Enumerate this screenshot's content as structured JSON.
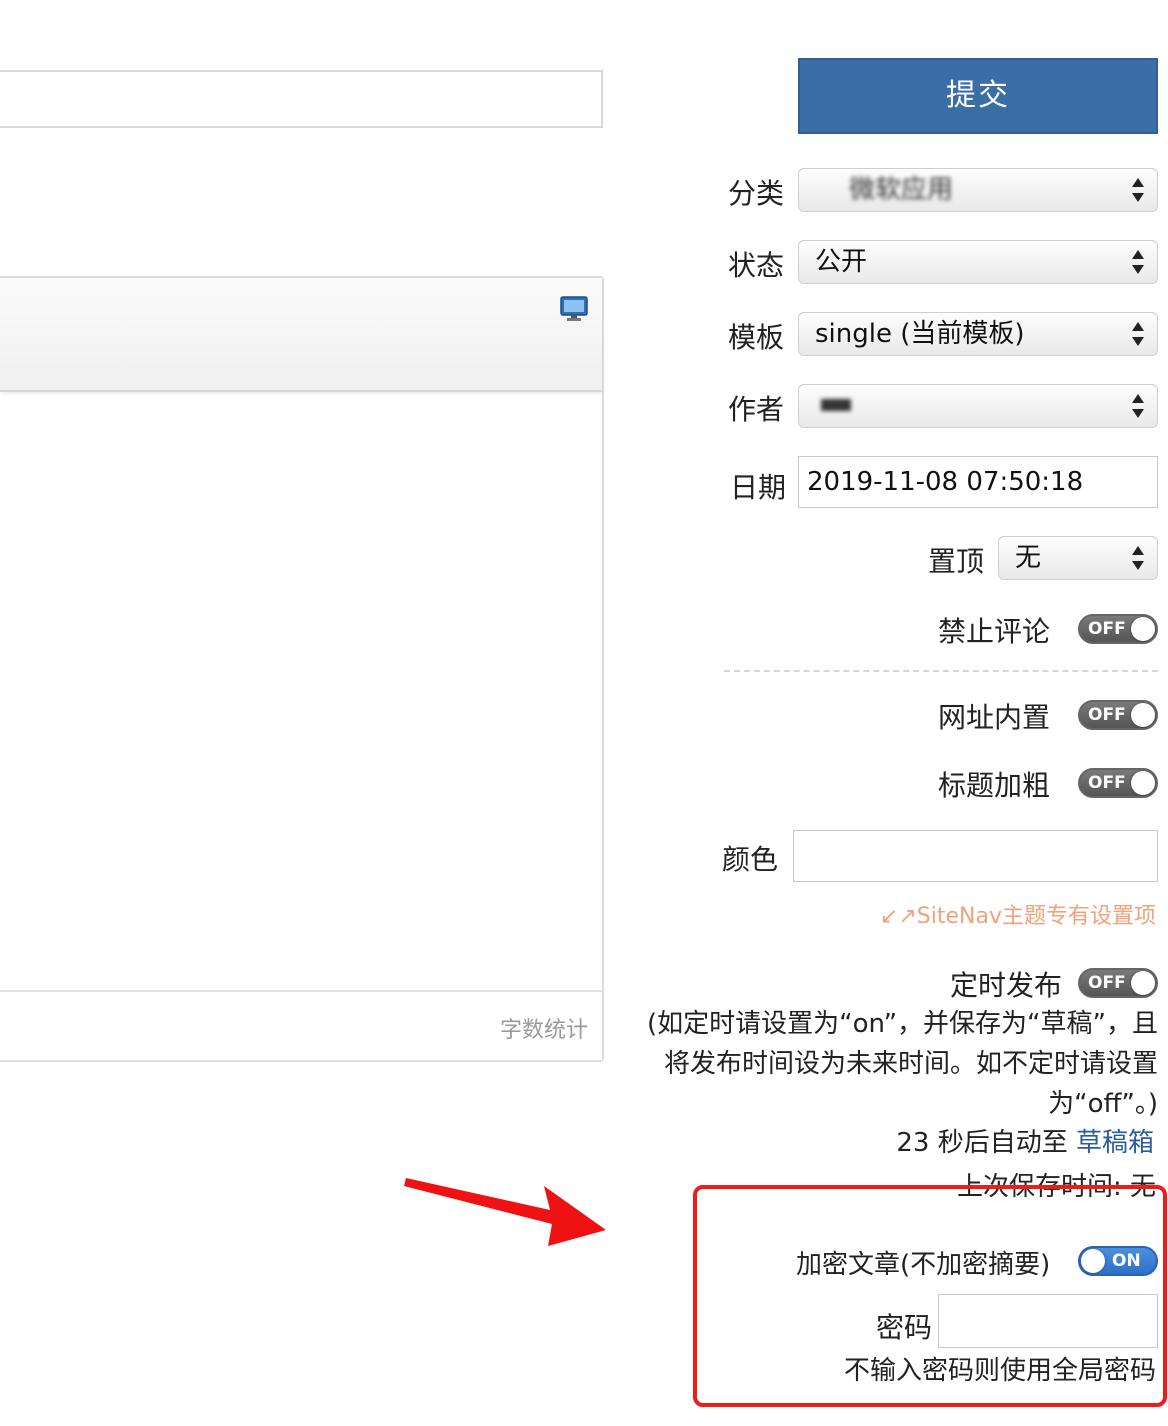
{
  "submit_label": "提交",
  "fields": {
    "category": {
      "label": "分类",
      "value": "微软应用"
    },
    "status": {
      "label": "状态",
      "value": "公开"
    },
    "template": {
      "label": "模板",
      "value": "single (当前模板)"
    },
    "author": {
      "label": "作者",
      "value": ""
    },
    "date": {
      "label": "日期",
      "value": "2019-11-08 07:50:18"
    },
    "sticky": {
      "label": "置顶",
      "value": "无"
    },
    "disable_comments": {
      "label": "禁止评论",
      "state": "OFF"
    },
    "url_builtin": {
      "label": "网址内置",
      "state": "OFF"
    },
    "bold_title": {
      "label": "标题加粗",
      "state": "OFF"
    },
    "color": {
      "label": "颜色",
      "value": ""
    },
    "theme_note": "↙↗SiteNav主题专有设置项",
    "scheduled": {
      "label": "定时发布",
      "state": "OFF"
    },
    "scheduled_help": "(如定时请设置为“on”，并保存为“草稿”，且将发布时间设为未来时间。如不定时请设置为“off”。)",
    "encrypt": {
      "label": "加密文章(不加密摘要)",
      "state": "ON"
    },
    "password": {
      "label": "密码",
      "value": "",
      "hint": "不输入密码则使用全局密码"
    }
  },
  "autosave": {
    "prefix": "23 秒后自动至 ",
    "link": "草稿箱",
    "last_saved": "上次保存时间: 无"
  },
  "editor": {
    "word_count_label": "字数统计"
  },
  "colors": {
    "submit_bg": "#3a6ea5",
    "toggle_on": "#2e6fc8",
    "toggle_off": "#555555",
    "highlight_box": "#ee1b1b",
    "theme_note": "#f0a27a",
    "link": "#2a5d9a"
  },
  "icons": {
    "preview": "monitor-icon",
    "select_arrows": "updown-arrows-icon",
    "annotation": "red-arrow-icon"
  }
}
